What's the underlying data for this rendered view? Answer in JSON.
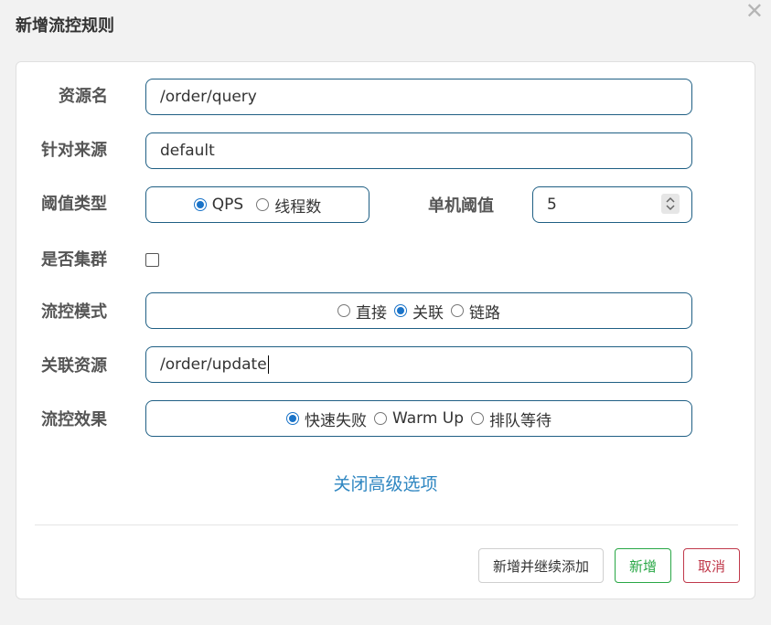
{
  "dialog": {
    "title": "新增流控规则"
  },
  "form": {
    "resource_name": {
      "label": "资源名",
      "value": "/order/query"
    },
    "limit_app": {
      "label": "针对来源",
      "value": "default"
    },
    "threshold_type": {
      "label": "阈值类型",
      "options": [
        "QPS",
        "线程数"
      ],
      "selected": "QPS"
    },
    "single_threshold": {
      "label": "单机阈值",
      "value": "5"
    },
    "cluster_mode": {
      "label": "是否集群",
      "checked": false
    },
    "strategy": {
      "label": "流控模式",
      "options": [
        "直接",
        "关联",
        "链路"
      ],
      "selected": "关联"
    },
    "ref_resource": {
      "label": "关联资源",
      "value": "/order/update"
    },
    "control_behavior": {
      "label": "流控效果",
      "options": [
        "快速失败",
        "Warm Up",
        "排队等待"
      ],
      "selected": "快速失败"
    },
    "advanced_link": "关闭高级选项"
  },
  "footer": {
    "add_continue_label": "新增并继续添加",
    "add_label": "新增",
    "cancel_label": "取消"
  },
  "colors": {
    "input_border": "#1f5f84",
    "radio_accent": "#1a73c8",
    "link": "#2e86c1",
    "success": "#28a745",
    "danger": "#c0394b"
  }
}
